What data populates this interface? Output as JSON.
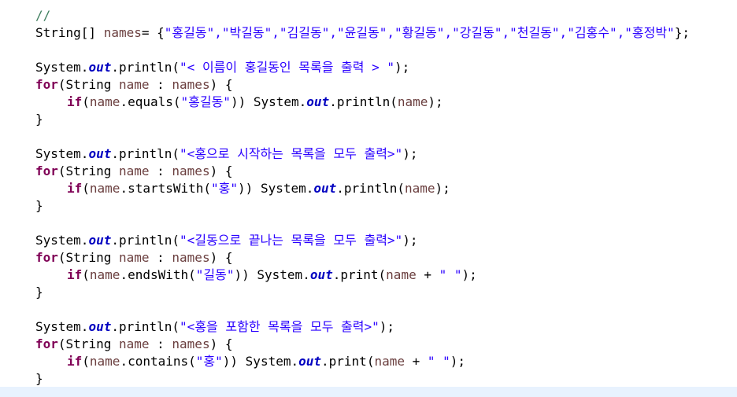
{
  "editor": {
    "comment": "//",
    "decl": {
      "type": "String[]",
      "var": "names",
      "op": "= {",
      "values": "\"홍길동\",\"박길동\",\"김길동\",\"윤길동\",\"황길동\",\"강길동\",\"천길동\",\"김홍수\",\"홍정박\"",
      "end": "};"
    },
    "kw_for": "for",
    "kw_if": "if",
    "system": "System.",
    "out": "out",
    "println": ".println(",
    "print": ".print(",
    "close_paren": ");",
    "open_brace": "{",
    "close_brace": "}",
    "for_open": "(String ",
    "for_var": "name",
    "for_mid": " : ",
    "for_arr": "names",
    "for_close": ") {",
    "if_open": "(",
    "if_var": "name",
    "println_name_var": "name",
    "print_var": "name",
    "concat": " + ",
    "space_str": "\" \"",
    "blocks": [
      {
        "message": "\"< 이름이 홍길동인 목록을 출력 > \"",
        "method": ".equals(",
        "arg": "\"홍길동\"",
        "after_arg": ")) "
      },
      {
        "message": "\"<홍으로 시작하는 목록을 모두 출력>\"",
        "method": ".startsWith(",
        "arg": "\"홍\"",
        "after_arg": ")) "
      },
      {
        "message": "\"<길동으로 끝나는 목록을 모두 출력>\"",
        "method": ".endsWith(",
        "arg": "\"길동\"",
        "after_arg": ")) "
      },
      {
        "message": "\"<홍을 포함한 목록을 모두 출력>\"",
        "method": ".contains(",
        "arg": "\"홍\"",
        "after_arg": ")) "
      }
    ]
  }
}
